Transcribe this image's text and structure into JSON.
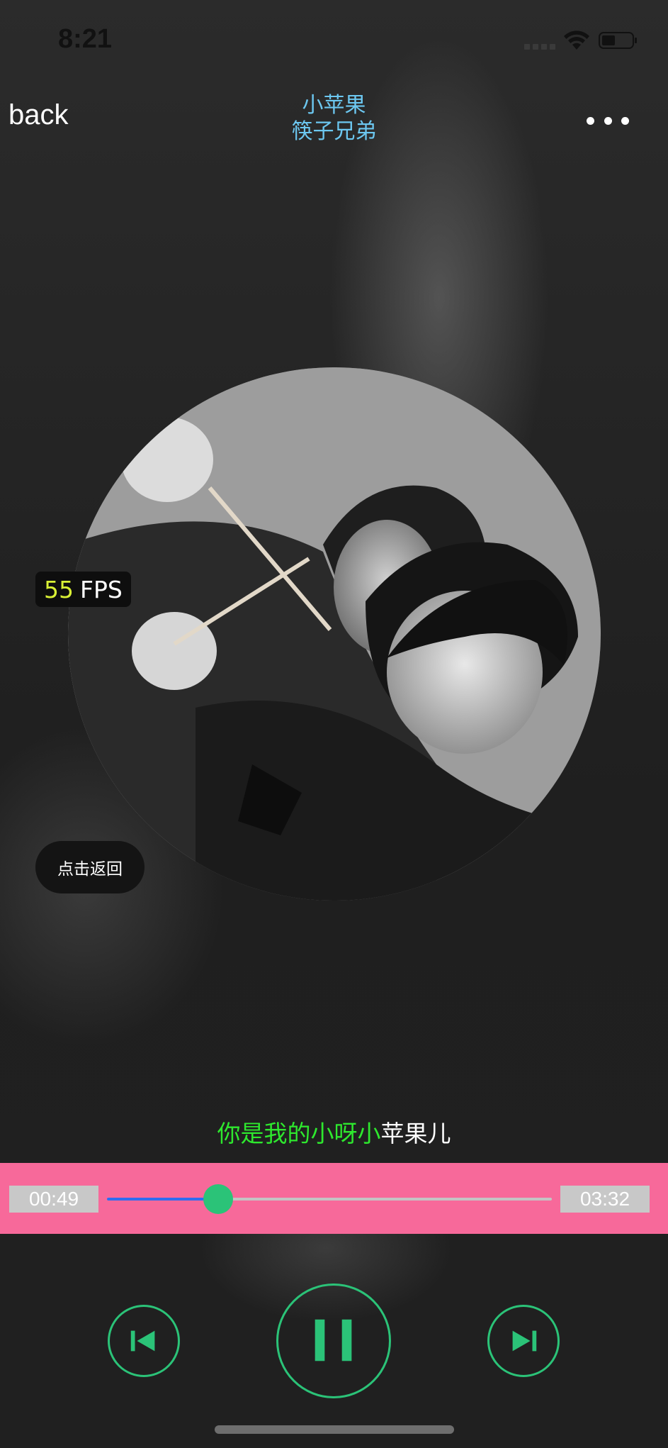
{
  "status_bar": {
    "time": "8:21"
  },
  "nav": {
    "back_label": "back",
    "song_title": "小苹果",
    "artist": "筷子兄弟",
    "more_icon": "more-horizontal-icon"
  },
  "overlay": {
    "fps_value": "55",
    "fps_unit": "FPS",
    "toast_label": "点击返回"
  },
  "lyric": {
    "sung": "你是我的小呀小",
    "rest": "苹果儿"
  },
  "player": {
    "current_time": "00:49",
    "total_time": "03:32",
    "progress": 0.25
  },
  "controls": {
    "prev_icon": "skip-previous-icon",
    "play_pause_icon": "pause-icon",
    "next_icon": "skip-next-icon"
  },
  "colors": {
    "accent": "#2bc378",
    "progress_bg": "#f7699a",
    "title": "#6cc7f0",
    "lyric_highlight": "#2ee82e",
    "track_fill": "#2f6cf0"
  }
}
